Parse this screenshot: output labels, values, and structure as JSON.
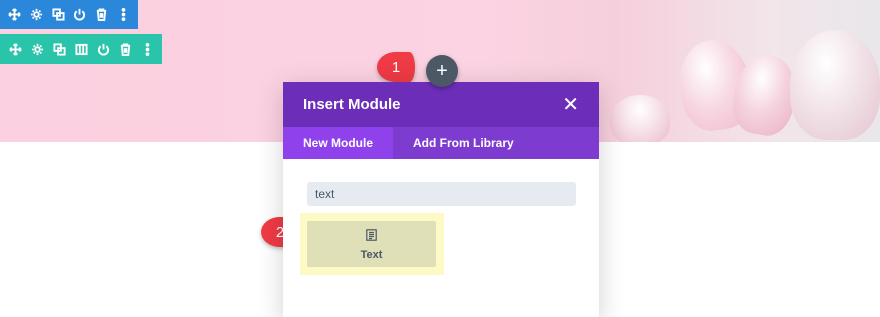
{
  "section_toolbar": {
    "color": "#2b87da",
    "icons": [
      "move-icon",
      "gear-icon",
      "duplicate-icon",
      "power-icon",
      "trash-icon",
      "more-icon"
    ]
  },
  "row_toolbar": {
    "color": "#29c4a9",
    "icons": [
      "move-icon",
      "gear-icon",
      "duplicate-icon",
      "columns-icon",
      "power-icon",
      "trash-icon",
      "more-icon"
    ]
  },
  "steps": {
    "one": "1",
    "two": "2"
  },
  "add_button": {
    "symbol": "+"
  },
  "modal": {
    "title": "Insert Module",
    "close_symbol": "✕",
    "tabs": [
      {
        "label": "New Module",
        "active": true
      },
      {
        "label": "Add From Library",
        "active": false
      }
    ],
    "search_value": "text",
    "results": [
      {
        "label": "Text",
        "icon": "text-module-icon"
      }
    ]
  },
  "colors": {
    "modal_header": "#6c2eb9",
    "tabs_bg": "#7e3bd0",
    "active_tab": "#8f42ec",
    "badge": "#ef3b45",
    "highlight": "#fdfac6"
  }
}
